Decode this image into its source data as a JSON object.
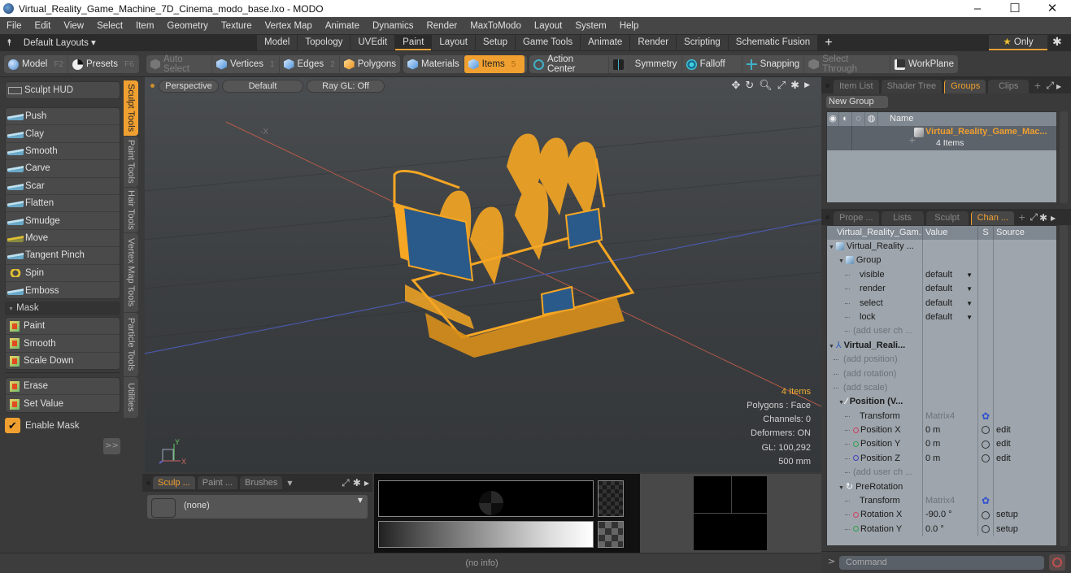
{
  "window": {
    "title": "Virtual_Reality_Game_Machine_7D_Cinema_modo_base.lxo - MODO",
    "controls": [
      "–",
      "☐",
      "✕"
    ]
  },
  "menu": [
    "File",
    "Edit",
    "View",
    "Select",
    "Item",
    "Geometry",
    "Texture",
    "Vertex Map",
    "Animate",
    "Dynamics",
    "Render",
    "MaxToModo",
    "Layout",
    "System",
    "Help"
  ],
  "layoutbar": {
    "layouts_label": "Default Layouts ▾",
    "tabs": [
      "Model",
      "Topology",
      "UVEdit",
      "Paint",
      "Layout",
      "Setup",
      "Game Tools",
      "Animate",
      "Render",
      "Scripting",
      "Schematic Fusion"
    ],
    "active_tab": "Paint",
    "add_label": "+",
    "only_label": "Only"
  },
  "toolbar": {
    "model": {
      "label": "Model",
      "key": "F2"
    },
    "presets": {
      "label": "Presets",
      "key": "F6"
    },
    "auto_select": "Auto Select",
    "vertices": {
      "label": "Vertices",
      "key": "1"
    },
    "edges": {
      "label": "Edges",
      "key": "2"
    },
    "polygons": {
      "label": "Polygons"
    },
    "materials": "Materials",
    "items": {
      "label": "Items",
      "key": "5"
    },
    "action_center": "Action Center",
    "symmetry": "Symmetry",
    "falloff": "Falloff",
    "snapping": "Snapping",
    "select_through": "Select Through",
    "workplane": "WorkPlane"
  },
  "left_panel": {
    "sculpt_hud": "Sculpt HUD",
    "sculpt_tools": [
      "Push",
      "Clay",
      "Smooth",
      "Carve",
      "Scar",
      "Flatten",
      "Smudge",
      "Move",
      "Tangent Pinch",
      "Spin",
      "Emboss"
    ],
    "mask_header": "Mask",
    "mask_tools": [
      "Paint",
      "Smooth",
      "Scale Down"
    ],
    "mask_tools2": [
      "Erase",
      "Set Value"
    ],
    "enable_mask": {
      "label": "Enable Mask",
      "checked": true
    },
    "expand_label": ">>",
    "vertical_tabs": [
      "Sculpt Tools",
      "Paint Tools",
      "Hair Tools",
      "Vertex Map Tools",
      "Particle Tools",
      "Utilities"
    ],
    "active_vertical_tab": "Sculpt Tools"
  },
  "viewport": {
    "view_mode": "Perspective",
    "shading": "Default",
    "raygl": "Ray GL: Off",
    "axis_label": "-X",
    "info": {
      "items": "4 Items",
      "polygons": "Polygons : Face",
      "channels": "Channels: 0",
      "deformers": "Deformers: ON",
      "gl": "GL: 100,292",
      "scale": "500 mm"
    },
    "gizmo": {
      "y": "Y",
      "x": "X"
    }
  },
  "bottom_left": {
    "tabs": [
      "Sculp ...",
      "Paint ...",
      "Brushes"
    ],
    "active_tab": "Sculp ...",
    "brush_value": "(none)"
  },
  "statusbar": {
    "text": "(no info)"
  },
  "groups_panel": {
    "tabs": [
      "Item List",
      "Shader Tree",
      "Groups",
      "Clips"
    ],
    "active_tab": "Groups",
    "new_group": "New Group",
    "column_name": "Name",
    "group": {
      "name": "Virtual_Reality_Game_Mac...",
      "count": "4 Items"
    }
  },
  "channels_panel": {
    "tabs": [
      "Prope ...",
      "Lists",
      "Sculpt",
      "Chan ..."
    ],
    "active_tab": "Chan ...",
    "headers": [
      "Virtual_Reality_Gam...",
      "Value",
      "S",
      "Source"
    ],
    "rows": [
      {
        "name": "Virtual_Reality ...",
        "value": "",
        "s": "",
        "source": "",
        "style": "root"
      },
      {
        "name": "Group",
        "value": "",
        "s": "",
        "source": "",
        "style": "group"
      },
      {
        "name": "visible",
        "value": "default",
        "s": "",
        "source": "",
        "style": "dropdown"
      },
      {
        "name": "render",
        "value": "default",
        "s": "",
        "source": "",
        "style": "dropdown"
      },
      {
        "name": "select",
        "value": "default",
        "s": "",
        "source": "",
        "style": "dropdown"
      },
      {
        "name": "lock",
        "value": "default",
        "s": "",
        "source": "",
        "style": "dropdown"
      },
      {
        "name": "(add user ch ...",
        "value": "",
        "s": "",
        "source": "",
        "style": "add"
      },
      {
        "name": "Virtual_Reali...",
        "value": "",
        "s": "",
        "source": "",
        "style": "locator"
      },
      {
        "name": "(add position)",
        "value": "",
        "s": "",
        "source": "",
        "style": "add1"
      },
      {
        "name": "(add rotation)",
        "value": "",
        "s": "",
        "source": "",
        "style": "add1"
      },
      {
        "name": "(add scale)",
        "value": "",
        "s": "",
        "source": "",
        "style": "add1"
      },
      {
        "name": "Position (V...",
        "value": "",
        "s": "",
        "source": "",
        "style": "xform"
      },
      {
        "name": "Transform",
        "value": "Matrix4",
        "s": "gear",
        "source": "",
        "style": "matrix"
      },
      {
        "name": "Position X",
        "value": "0 m",
        "s": "circle",
        "source": "edit",
        "style": "x"
      },
      {
        "name": "Position Y",
        "value": "0 m",
        "s": "circle",
        "source": "edit",
        "style": "y"
      },
      {
        "name": "Position Z",
        "value": "0 m",
        "s": "circle",
        "source": "edit",
        "style": "z"
      },
      {
        "name": "(add user ch ...",
        "value": "",
        "s": "",
        "source": "",
        "style": "add"
      },
      {
        "name": "PreRotation",
        "value": "",
        "s": "",
        "source": "",
        "style": "xform2"
      },
      {
        "name": "Transform",
        "value": "Matrix4",
        "s": "gear",
        "source": "",
        "style": "matrix"
      },
      {
        "name": "Rotation X",
        "value": "-90.0 °",
        "s": "circle",
        "source": "setup",
        "style": "x"
      },
      {
        "name": "Rotation Y",
        "value": "0.0 °",
        "s": "circle",
        "source": "setup",
        "style": "y"
      }
    ]
  },
  "command": {
    "placeholder": "Command",
    "prompt": ">"
  },
  "colors": {
    "accent": "#f0a030",
    "wire": "#f5a623",
    "x_axis": "#d05a4a",
    "z_axis": "#4a5ab0"
  }
}
